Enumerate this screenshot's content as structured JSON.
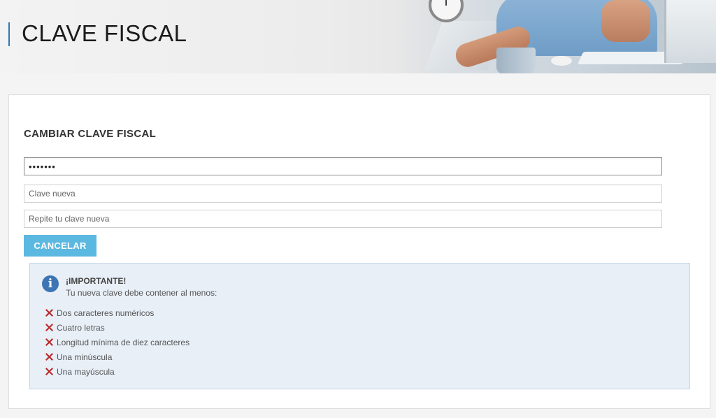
{
  "header": {
    "title": "CLAVE FISCAL"
  },
  "form": {
    "title": "CAMBIAR CLAVE FISCAL",
    "current_password_value": "•••••••",
    "new_password_placeholder": "Clave nueva",
    "repeat_password_placeholder": "Repite tu clave nueva",
    "cancel_label": "CANCELAR"
  },
  "info": {
    "title": "¡IMPORTANTE!",
    "subtitle": "Tu nueva clave debe contener al menos:",
    "requirements": [
      {
        "label": "Dos caracteres numéricos",
        "status": "x-icon"
      },
      {
        "label": "Cuatro letras",
        "status": "x-icon"
      },
      {
        "label": "Longitud mínima de diez caracteres",
        "status": "x-icon"
      },
      {
        "label": "Una minúscula",
        "status": "x-icon"
      },
      {
        "label": "Una mayúscula",
        "status": "x-icon"
      }
    ]
  },
  "colors": {
    "accent_blue": "#2a78b8",
    "button_blue": "#5bb8e0",
    "info_bg": "#e8eff7",
    "error_red": "#b92b2b"
  }
}
